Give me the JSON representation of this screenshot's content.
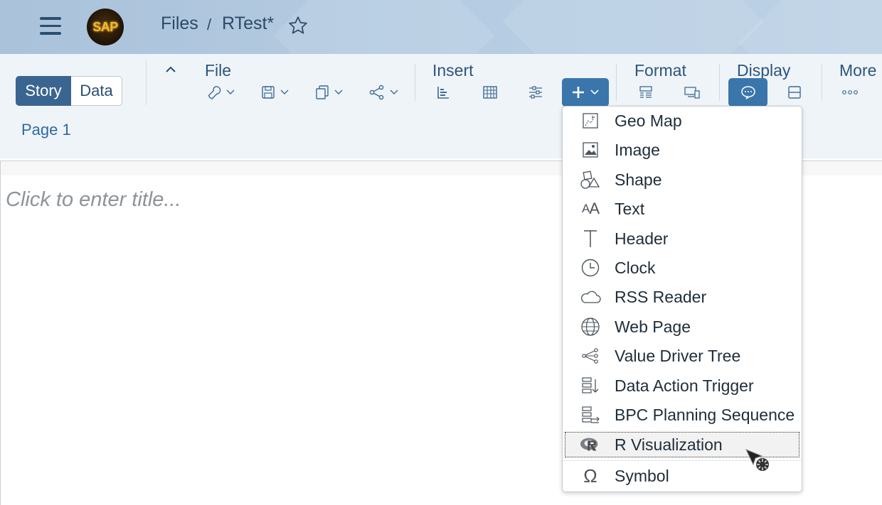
{
  "shell": {
    "breadcrumb_root": "Files",
    "breadcrumb_sep": "/",
    "document_name": "RTest*",
    "logo_text": "SAP"
  },
  "toolbar": {
    "mode_story": "Story",
    "mode_data": "Data",
    "page_tab": "Page 1",
    "groups": {
      "file": "File",
      "insert": "Insert",
      "format": "Format",
      "display": "Display",
      "more": "More"
    }
  },
  "canvas": {
    "title_placeholder": "Click to enter title..."
  },
  "insert_menu": {
    "items": [
      {
        "label": "Geo Map",
        "icon": "geo-map-icon"
      },
      {
        "label": "Image",
        "icon": "image-icon"
      },
      {
        "label": "Shape",
        "icon": "shape-icon"
      },
      {
        "label": "Text",
        "icon": "text-icon"
      },
      {
        "label": "Header",
        "icon": "header-icon"
      },
      {
        "label": "Clock",
        "icon": "clock-icon"
      },
      {
        "label": "RSS Reader",
        "icon": "cloud-icon"
      },
      {
        "label": "Web Page",
        "icon": "globe-icon"
      },
      {
        "label": "Value Driver Tree",
        "icon": "tree-icon"
      },
      {
        "label": "Data Action Trigger",
        "icon": "data-action-icon"
      },
      {
        "label": "BPC Planning Sequence",
        "icon": "planning-sequence-icon"
      },
      {
        "label": "R Visualization",
        "icon": "r-icon",
        "selected": true
      },
      {
        "label": "Symbol",
        "icon": "omega-icon"
      }
    ]
  },
  "colors": {
    "accent": "#3a76ab",
    "shell_bg": "#b4cbe1",
    "toolbar_bg": "#eff4f9",
    "link": "#2b6aa3"
  }
}
